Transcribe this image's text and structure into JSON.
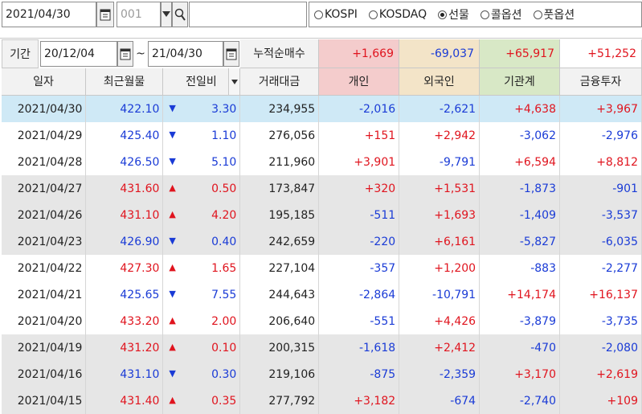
{
  "toolbar": {
    "date": "2021/04/30",
    "code": "001",
    "radios": [
      {
        "label": "KOSPI",
        "selected": false
      },
      {
        "label": "KOSDAQ",
        "selected": false
      },
      {
        "label": "선물",
        "selected": true
      },
      {
        "label": "콜옵션",
        "selected": false
      },
      {
        "label": "풋옵션",
        "selected": false
      }
    ]
  },
  "period": {
    "label": "기간",
    "from": "20/12/04",
    "tilde": "~",
    "to": "21/04/30",
    "cum_label": "누적순매수",
    "totals": [
      "+1,669",
      "-69,037",
      "+65,917",
      "+51,252"
    ]
  },
  "headers": [
    "일자",
    "최근월물",
    "전일비",
    "거래대금",
    "개인",
    "외국인",
    "기관계",
    "금융투자"
  ],
  "colors": {
    "individual_header": "#f4cccc",
    "foreign_header": "#f3e4c8",
    "institution_header": "#d8e8c6",
    "finance_header": "#f2f2f2",
    "up": "#e0141e",
    "down": "#1a3bd6",
    "selected_row": "#cfe9f6",
    "gray_row": "#e6e6e6"
  },
  "rows": [
    {
      "date": "2021/04/30",
      "price": "422.10",
      "dir": "down",
      "change": "3.30",
      "amount": "234,955",
      "individual": "-2,016",
      "foreign": "-2,621",
      "institution": "+4,638",
      "finance": "+3,967"
    },
    {
      "date": "2021/04/29",
      "price": "425.40",
      "dir": "down",
      "change": "1.10",
      "amount": "276,056",
      "individual": "+151",
      "foreign": "+2,942",
      "institution": "-3,062",
      "finance": "-2,976"
    },
    {
      "date": "2021/04/28",
      "price": "426.50",
      "dir": "down",
      "change": "5.10",
      "amount": "211,960",
      "individual": "+3,901",
      "foreign": "-9,791",
      "institution": "+6,594",
      "finance": "+8,812"
    },
    {
      "date": "2021/04/27",
      "price": "431.60",
      "dir": "up",
      "change": "0.50",
      "amount": "173,847",
      "individual": "+320",
      "foreign": "+1,531",
      "institution": "-1,873",
      "finance": "-901"
    },
    {
      "date": "2021/04/26",
      "price": "431.10",
      "dir": "up",
      "change": "4.20",
      "amount": "195,185",
      "individual": "-511",
      "foreign": "+1,693",
      "institution": "-1,409",
      "finance": "-3,537"
    },
    {
      "date": "2021/04/23",
      "price": "426.90",
      "dir": "down",
      "change": "0.40",
      "amount": "242,659",
      "individual": "-220",
      "foreign": "+6,161",
      "institution": "-5,827",
      "finance": "-6,035"
    },
    {
      "date": "2021/04/22",
      "price": "427.30",
      "dir": "up",
      "change": "1.65",
      "amount": "227,104",
      "individual": "-357",
      "foreign": "+1,200",
      "institution": "-883",
      "finance": "-2,277"
    },
    {
      "date": "2021/04/21",
      "price": "425.65",
      "dir": "down",
      "change": "7.55",
      "amount": "244,643",
      "individual": "-2,864",
      "foreign": "-10,791",
      "institution": "+14,174",
      "finance": "+16,137"
    },
    {
      "date": "2021/04/20",
      "price": "433.20",
      "dir": "up",
      "change": "2.00",
      "amount": "206,640",
      "individual": "-551",
      "foreign": "+4,426",
      "institution": "-3,879",
      "finance": "-3,735"
    },
    {
      "date": "2021/04/19",
      "price": "431.20",
      "dir": "up",
      "change": "0.10",
      "amount": "200,315",
      "individual": "-1,618",
      "foreign": "+2,412",
      "institution": "-470",
      "finance": "-2,080"
    },
    {
      "date": "2021/04/16",
      "price": "431.10",
      "dir": "down",
      "change": "0.30",
      "amount": "219,106",
      "individual": "-875",
      "foreign": "-2,359",
      "institution": "+3,170",
      "finance": "+2,619"
    },
    {
      "date": "2021/04/15",
      "price": "431.40",
      "dir": "up",
      "change": "0.35",
      "amount": "277,792",
      "individual": "+3,182",
      "foreign": "-674",
      "institution": "-2,740",
      "finance": "+109"
    }
  ]
}
